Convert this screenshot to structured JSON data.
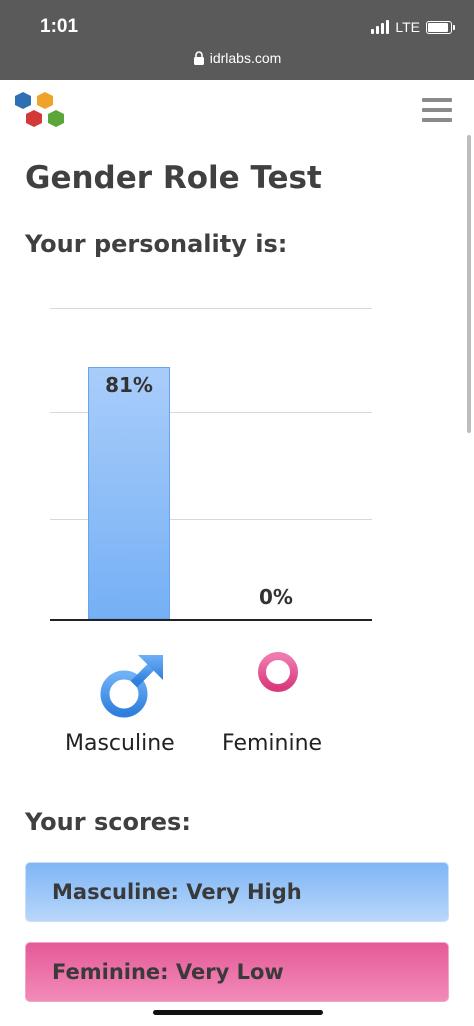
{
  "status_bar": {
    "time": "1:01",
    "network": "LTE",
    "battery_level": 0.9
  },
  "browser": {
    "url": "idrlabs.com"
  },
  "page": {
    "title": "Gender Role Test",
    "personality_heading": "Your personality is:",
    "scores_heading": "Your scores:"
  },
  "chart_data": {
    "type": "bar",
    "categories": [
      "Masculine",
      "Feminine"
    ],
    "values": [
      81,
      0
    ],
    "value_labels": [
      "81%",
      "0%"
    ],
    "ylim": [
      0,
      100
    ],
    "grid": true,
    "bar_colors": [
      "#7fb5f5",
      "#f28bb9"
    ]
  },
  "scores": [
    {
      "label": "Masculine: Very High",
      "color": "#7fb5f5"
    },
    {
      "label": "Feminine: Very Low",
      "color": "#e45a97"
    }
  ],
  "icons": {
    "logo": "idrlabs-hexagon-logo",
    "menu": "hamburger-menu-icon",
    "masculine": "male-symbol-icon",
    "feminine": "female-symbol-icon"
  },
  "colors": {
    "male": "#4a90e2",
    "female": "#e8488a"
  }
}
